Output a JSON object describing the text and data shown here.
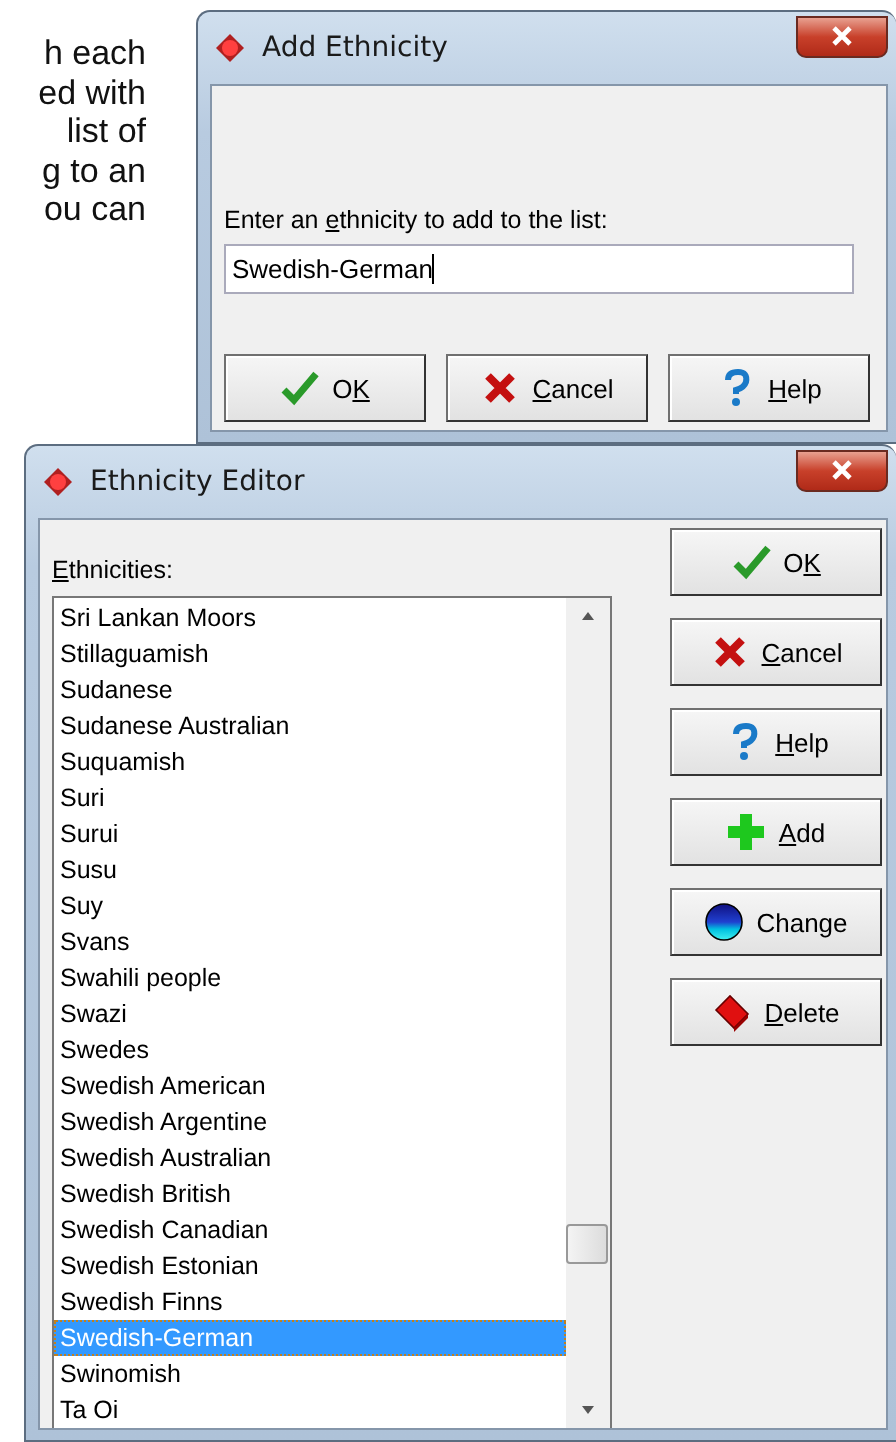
{
  "document_text": {
    "lines": [
      "h each",
      "ed with",
      "list of",
      "g to an",
      "ou can"
    ]
  },
  "add_dialog": {
    "title": "Add Ethnicity",
    "prompt": {
      "before": "Enter an ",
      "key": "e",
      "after": "thnicity to add to the list:"
    },
    "input": {
      "value": "Swedish-German"
    },
    "buttons": [
      {
        "kind": "ok",
        "before": "O",
        "key": "K"
      },
      {
        "kind": "cancel",
        "key": "C",
        "after": "ancel"
      },
      {
        "kind": "help",
        "key": "H",
        "after": "elp"
      }
    ]
  },
  "editor": {
    "title": "Ethnicity Editor",
    "list_label": {
      "key": "E",
      "after": "thnicities:"
    },
    "items": [
      {
        "label": "Sri Lankan Moors",
        "selected": false
      },
      {
        "label": "Stillaguamish",
        "selected": false
      },
      {
        "label": "Sudanese",
        "selected": false
      },
      {
        "label": "Sudanese Australian",
        "selected": false
      },
      {
        "label": "Suquamish",
        "selected": false
      },
      {
        "label": "Suri",
        "selected": false
      },
      {
        "label": "Surui",
        "selected": false
      },
      {
        "label": "Susu",
        "selected": false
      },
      {
        "label": "Suy",
        "selected": false
      },
      {
        "label": "Svans",
        "selected": false
      },
      {
        "label": "Swahili people",
        "selected": false
      },
      {
        "label": "Swazi",
        "selected": false
      },
      {
        "label": "Swedes",
        "selected": false
      },
      {
        "label": "Swedish American",
        "selected": false
      },
      {
        "label": "Swedish Argentine",
        "selected": false
      },
      {
        "label": "Swedish Australian",
        "selected": false
      },
      {
        "label": "Swedish British",
        "selected": false
      },
      {
        "label": "Swedish Canadian",
        "selected": false
      },
      {
        "label": "Swedish Estonian",
        "selected": false
      },
      {
        "label": "Swedish Finns",
        "selected": false
      },
      {
        "label": "Swedish-German",
        "selected": true
      },
      {
        "label": "Swinomish",
        "selected": false
      },
      {
        "label": "Ta Oi",
        "selected": false
      }
    ],
    "buttons": [
      {
        "kind": "ok",
        "before": "O",
        "key": "K"
      },
      {
        "kind": "cancel",
        "key": "C",
        "after": "ancel"
      },
      {
        "kind": "help",
        "key": "H",
        "after": "elp"
      },
      {
        "kind": "add",
        "key": "A",
        "after": "dd"
      },
      {
        "kind": "change",
        "before": "Change"
      },
      {
        "kind": "delete",
        "key": "D",
        "after": "elete"
      }
    ]
  }
}
